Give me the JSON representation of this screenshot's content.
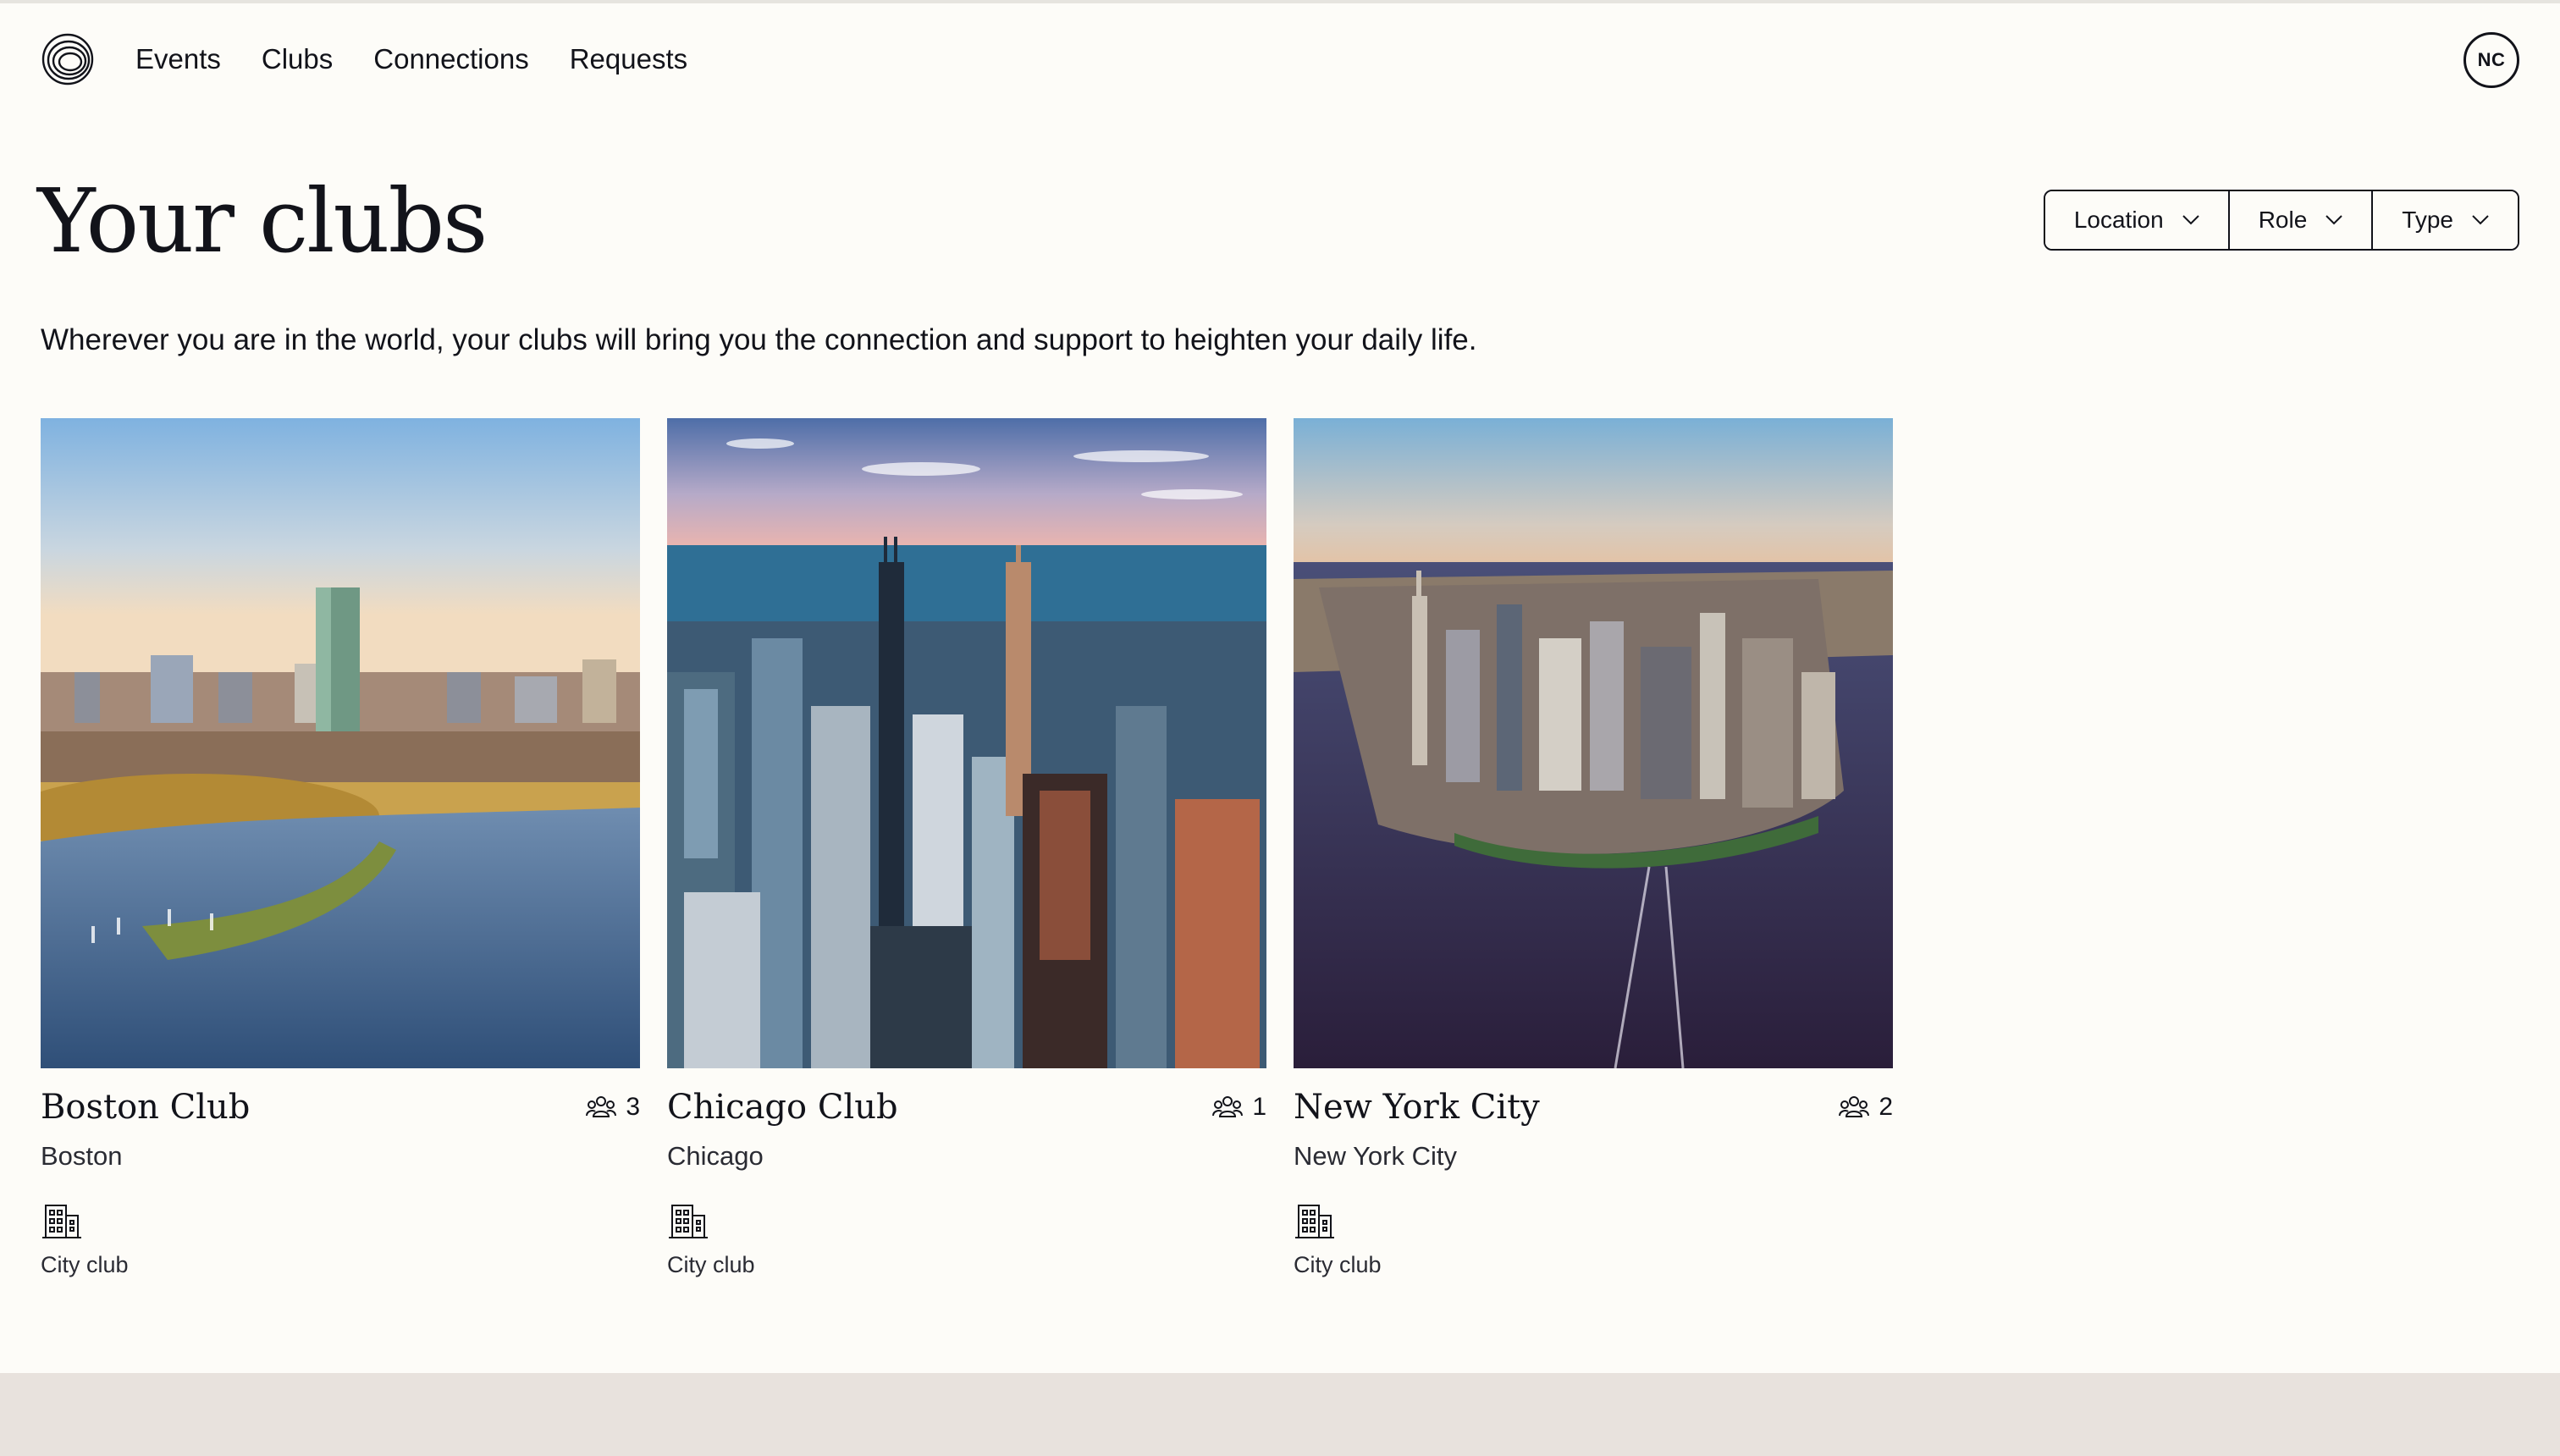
{
  "nav": {
    "items": [
      {
        "label": "Events"
      },
      {
        "label": "Clubs"
      },
      {
        "label": "Connections"
      },
      {
        "label": "Requests"
      }
    ],
    "avatar_initials": "NC"
  },
  "page": {
    "title": "Your clubs",
    "subtitle": "Wherever you are in the world, your clubs will bring you the connection and support to heighten your daily life."
  },
  "filters": [
    {
      "label": "Location"
    },
    {
      "label": "Role"
    },
    {
      "label": "Type"
    }
  ],
  "clubs": [
    {
      "name": "Boston Club",
      "members": "3",
      "city": "Boston",
      "type": "City club"
    },
    {
      "name": "Chicago Club",
      "members": "1",
      "city": "Chicago",
      "type": "City club"
    },
    {
      "name": "New York City",
      "members": "2",
      "city": "New York City",
      "type": "City club"
    }
  ],
  "icons": {
    "logo": "logo-icon",
    "chevron": "chevron-down-icon",
    "members": "members-icon",
    "building": "building-icon"
  },
  "colors": {
    "background": "#fdfcf8",
    "text": "#12131a",
    "footer": "#e8e2dd"
  }
}
